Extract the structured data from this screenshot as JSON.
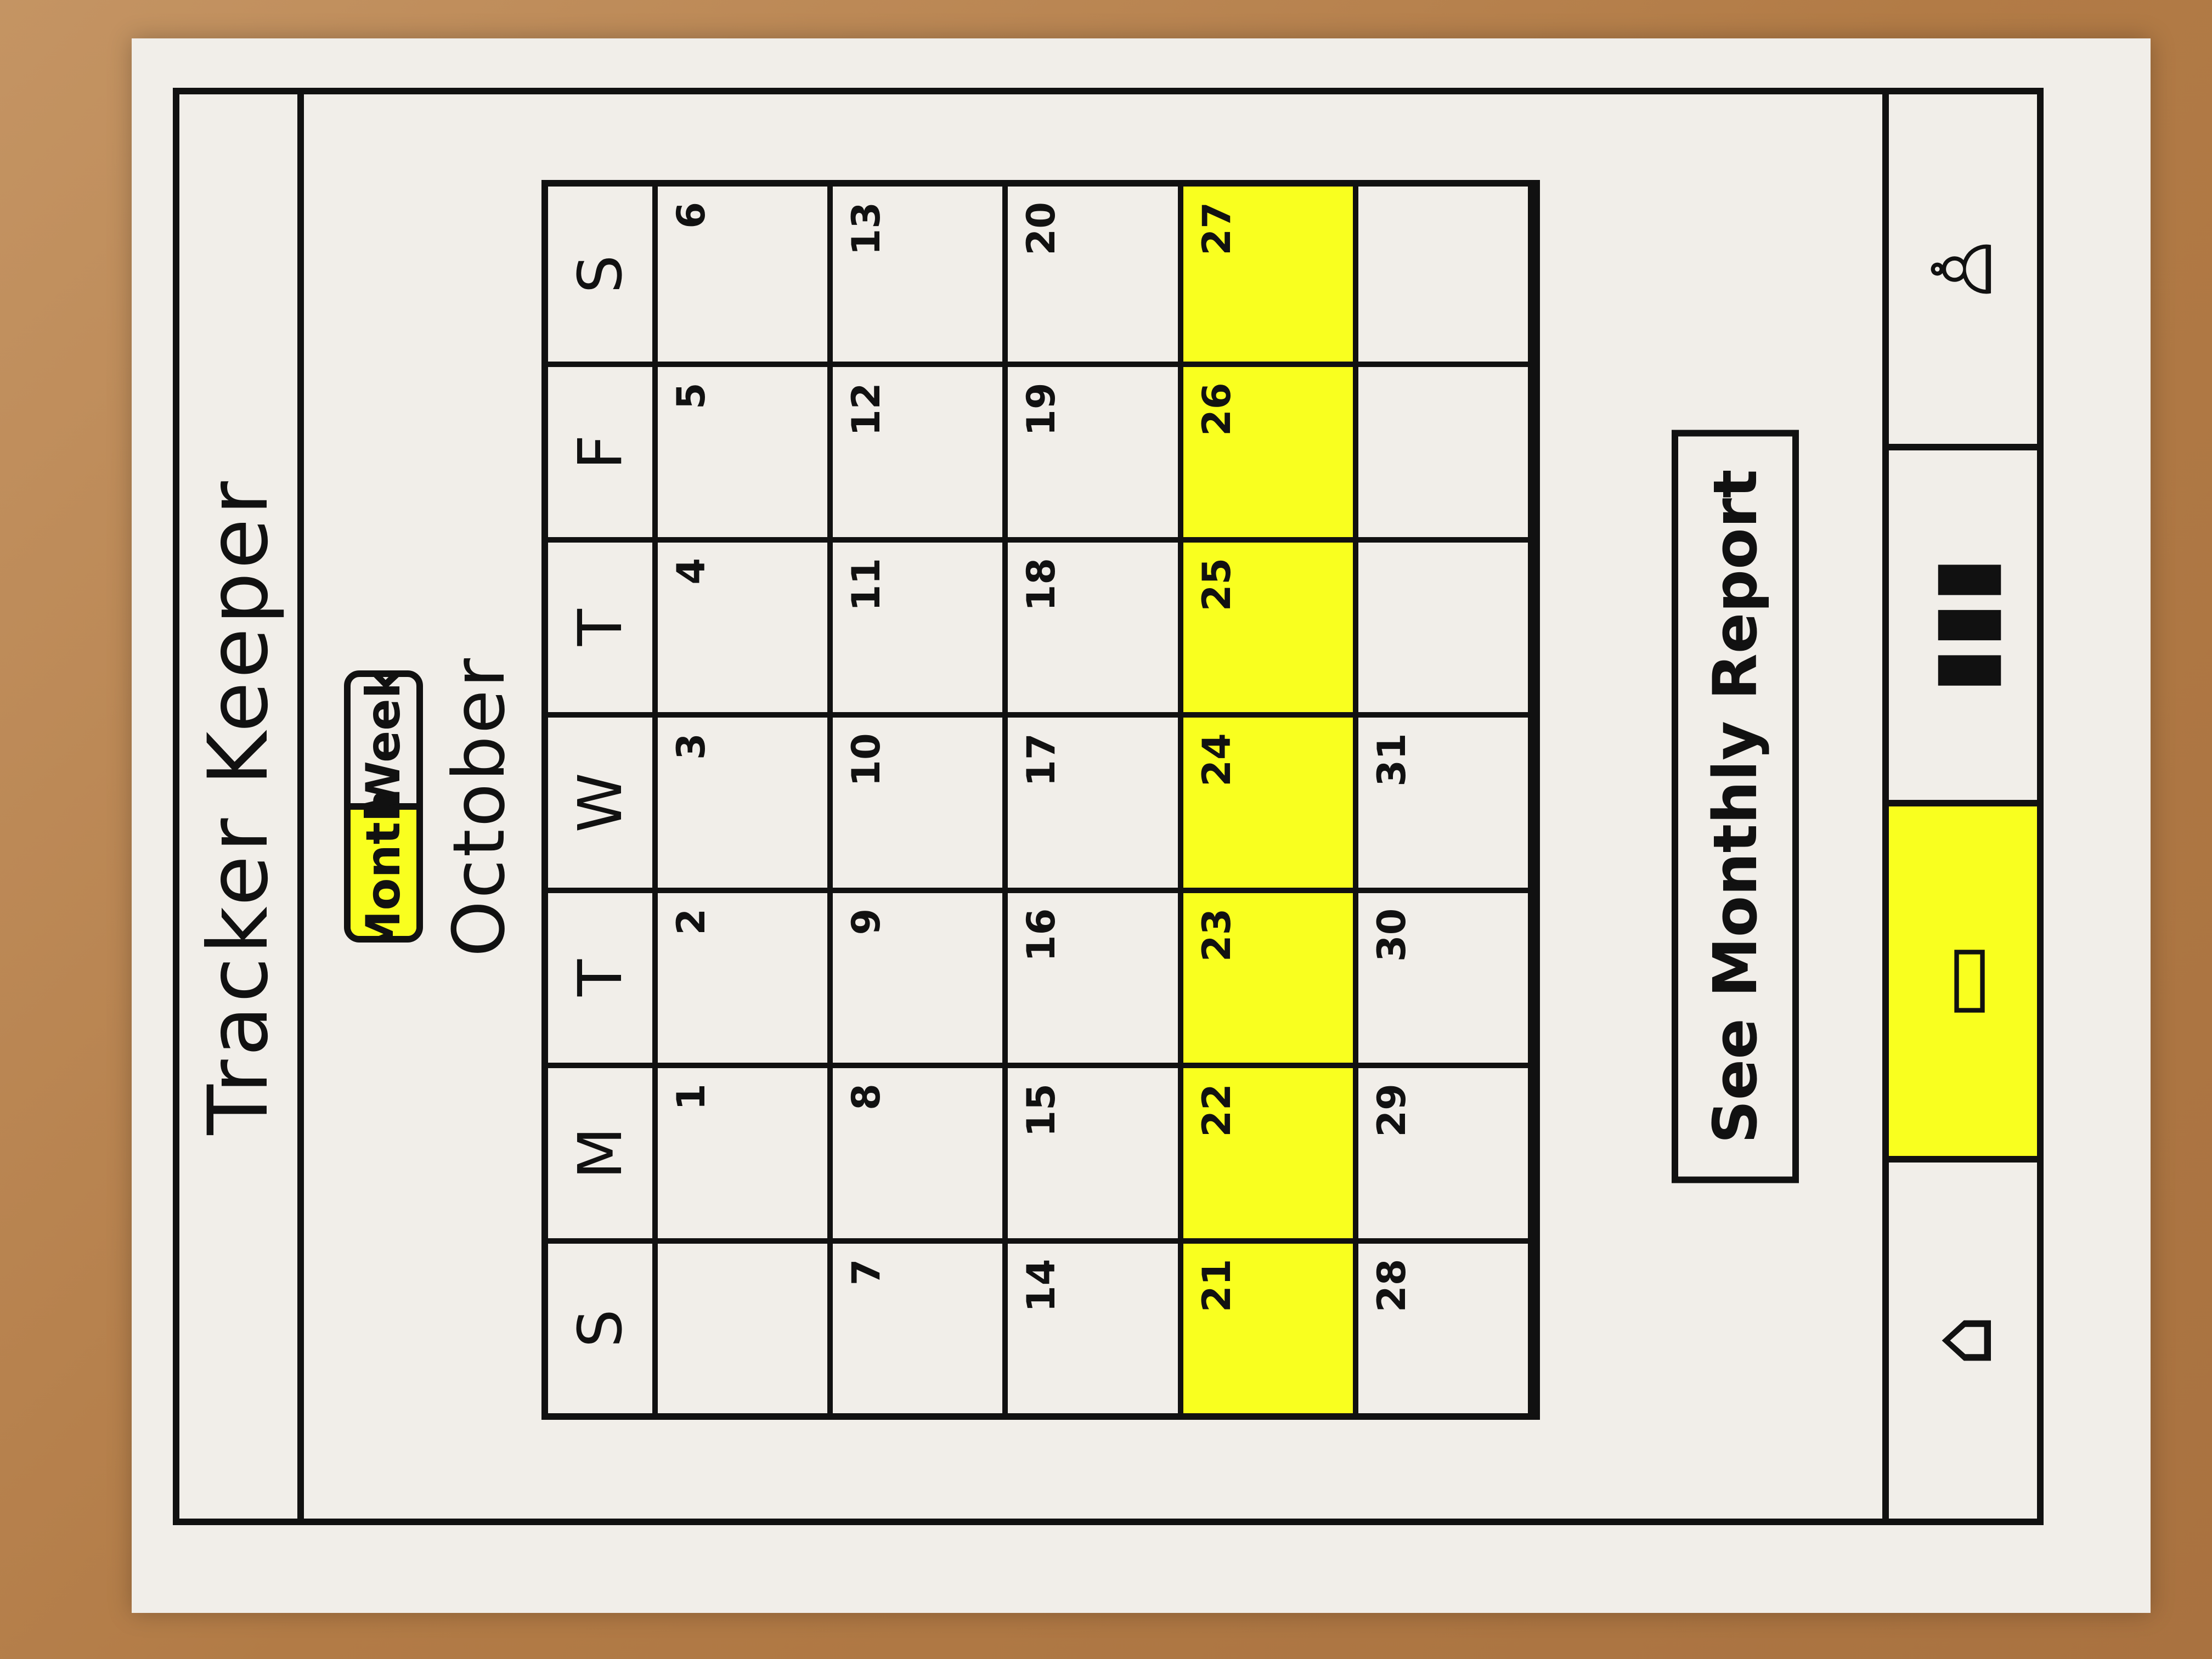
{
  "app": {
    "title": "Tracker Keeper"
  },
  "view_toggle": {
    "month_label": "Month",
    "week_label": "Week",
    "active": "month"
  },
  "calendar": {
    "month": "October",
    "weekdays": [
      "S",
      "M",
      "T",
      "W",
      "T",
      "F",
      "S"
    ],
    "weeks": [
      [
        "",
        "1",
        "2",
        "3",
        "4",
        "5",
        "6"
      ],
      [
        "7",
        "8",
        "9",
        "10",
        "11",
        "12",
        "13"
      ],
      [
        "14",
        "15",
        "16",
        "17",
        "18",
        "19",
        "20"
      ],
      [
        "21",
        "22",
        "23",
        "24",
        "25",
        "26",
        "27"
      ],
      [
        "28",
        "29",
        "30",
        "31",
        "",
        "",
        ""
      ]
    ],
    "highlighted_week": 3,
    "highlight_color": "#f9ff1f"
  },
  "report_button": {
    "label": "See Monthly Report"
  },
  "tabbar": {
    "items": [
      {
        "icon": "home-icon",
        "glyph": "⌂",
        "active": false
      },
      {
        "icon": "calendar-icon",
        "glyph": "▭",
        "active": true
      },
      {
        "icon": "bar-chart-icon",
        "glyph": "▮▮▮",
        "active": false
      },
      {
        "icon": "profile-icon",
        "glyph": "♙",
        "active": false
      }
    ]
  }
}
